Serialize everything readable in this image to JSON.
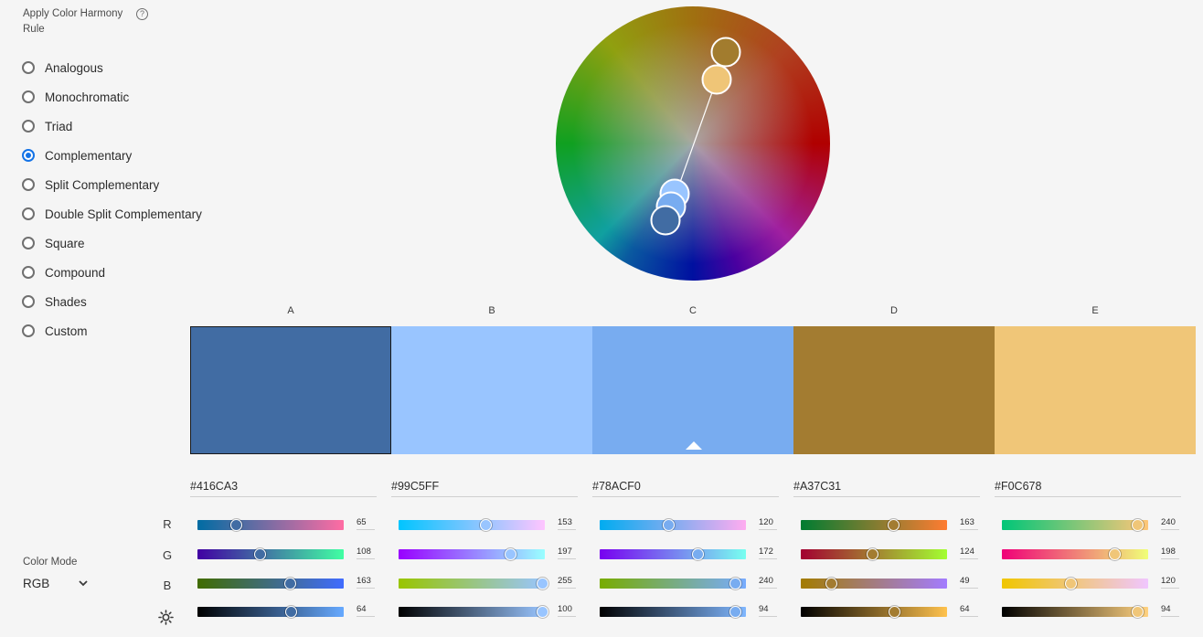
{
  "harmony": {
    "title": "Apply Color Harmony Rule",
    "help_icon": "question-mark-icon",
    "rules": [
      "Analogous",
      "Monochromatic",
      "Triad",
      "Complementary",
      "Split Complementary",
      "Double Split Complementary",
      "Square",
      "Compound",
      "Shades",
      "Custom"
    ],
    "selected": "Complementary"
  },
  "color_mode": {
    "title": "Color Mode",
    "value": "RGB"
  },
  "channel_labels": [
    "R",
    "G",
    "B"
  ],
  "brightness_icon": "sun-icon",
  "selected_swatch": "C",
  "swatches": [
    {
      "letter": "A",
      "hex": "#416CA3",
      "r": 65,
      "g": 108,
      "b": 163,
      "brightness": 64
    },
    {
      "letter": "B",
      "hex": "#99C5FF",
      "r": 153,
      "g": 197,
      "b": 255,
      "brightness": 100
    },
    {
      "letter": "C",
      "hex": "#78ACF0",
      "r": 120,
      "g": 172,
      "b": 240,
      "brightness": 94
    },
    {
      "letter": "D",
      "hex": "#A37C31",
      "r": 163,
      "g": 124,
      "b": 49,
      "brightness": 64
    },
    {
      "letter": "E",
      "hex": "#F0C678",
      "r": 240,
      "g": 198,
      "b": 120,
      "brightness": 94
    }
  ]
}
